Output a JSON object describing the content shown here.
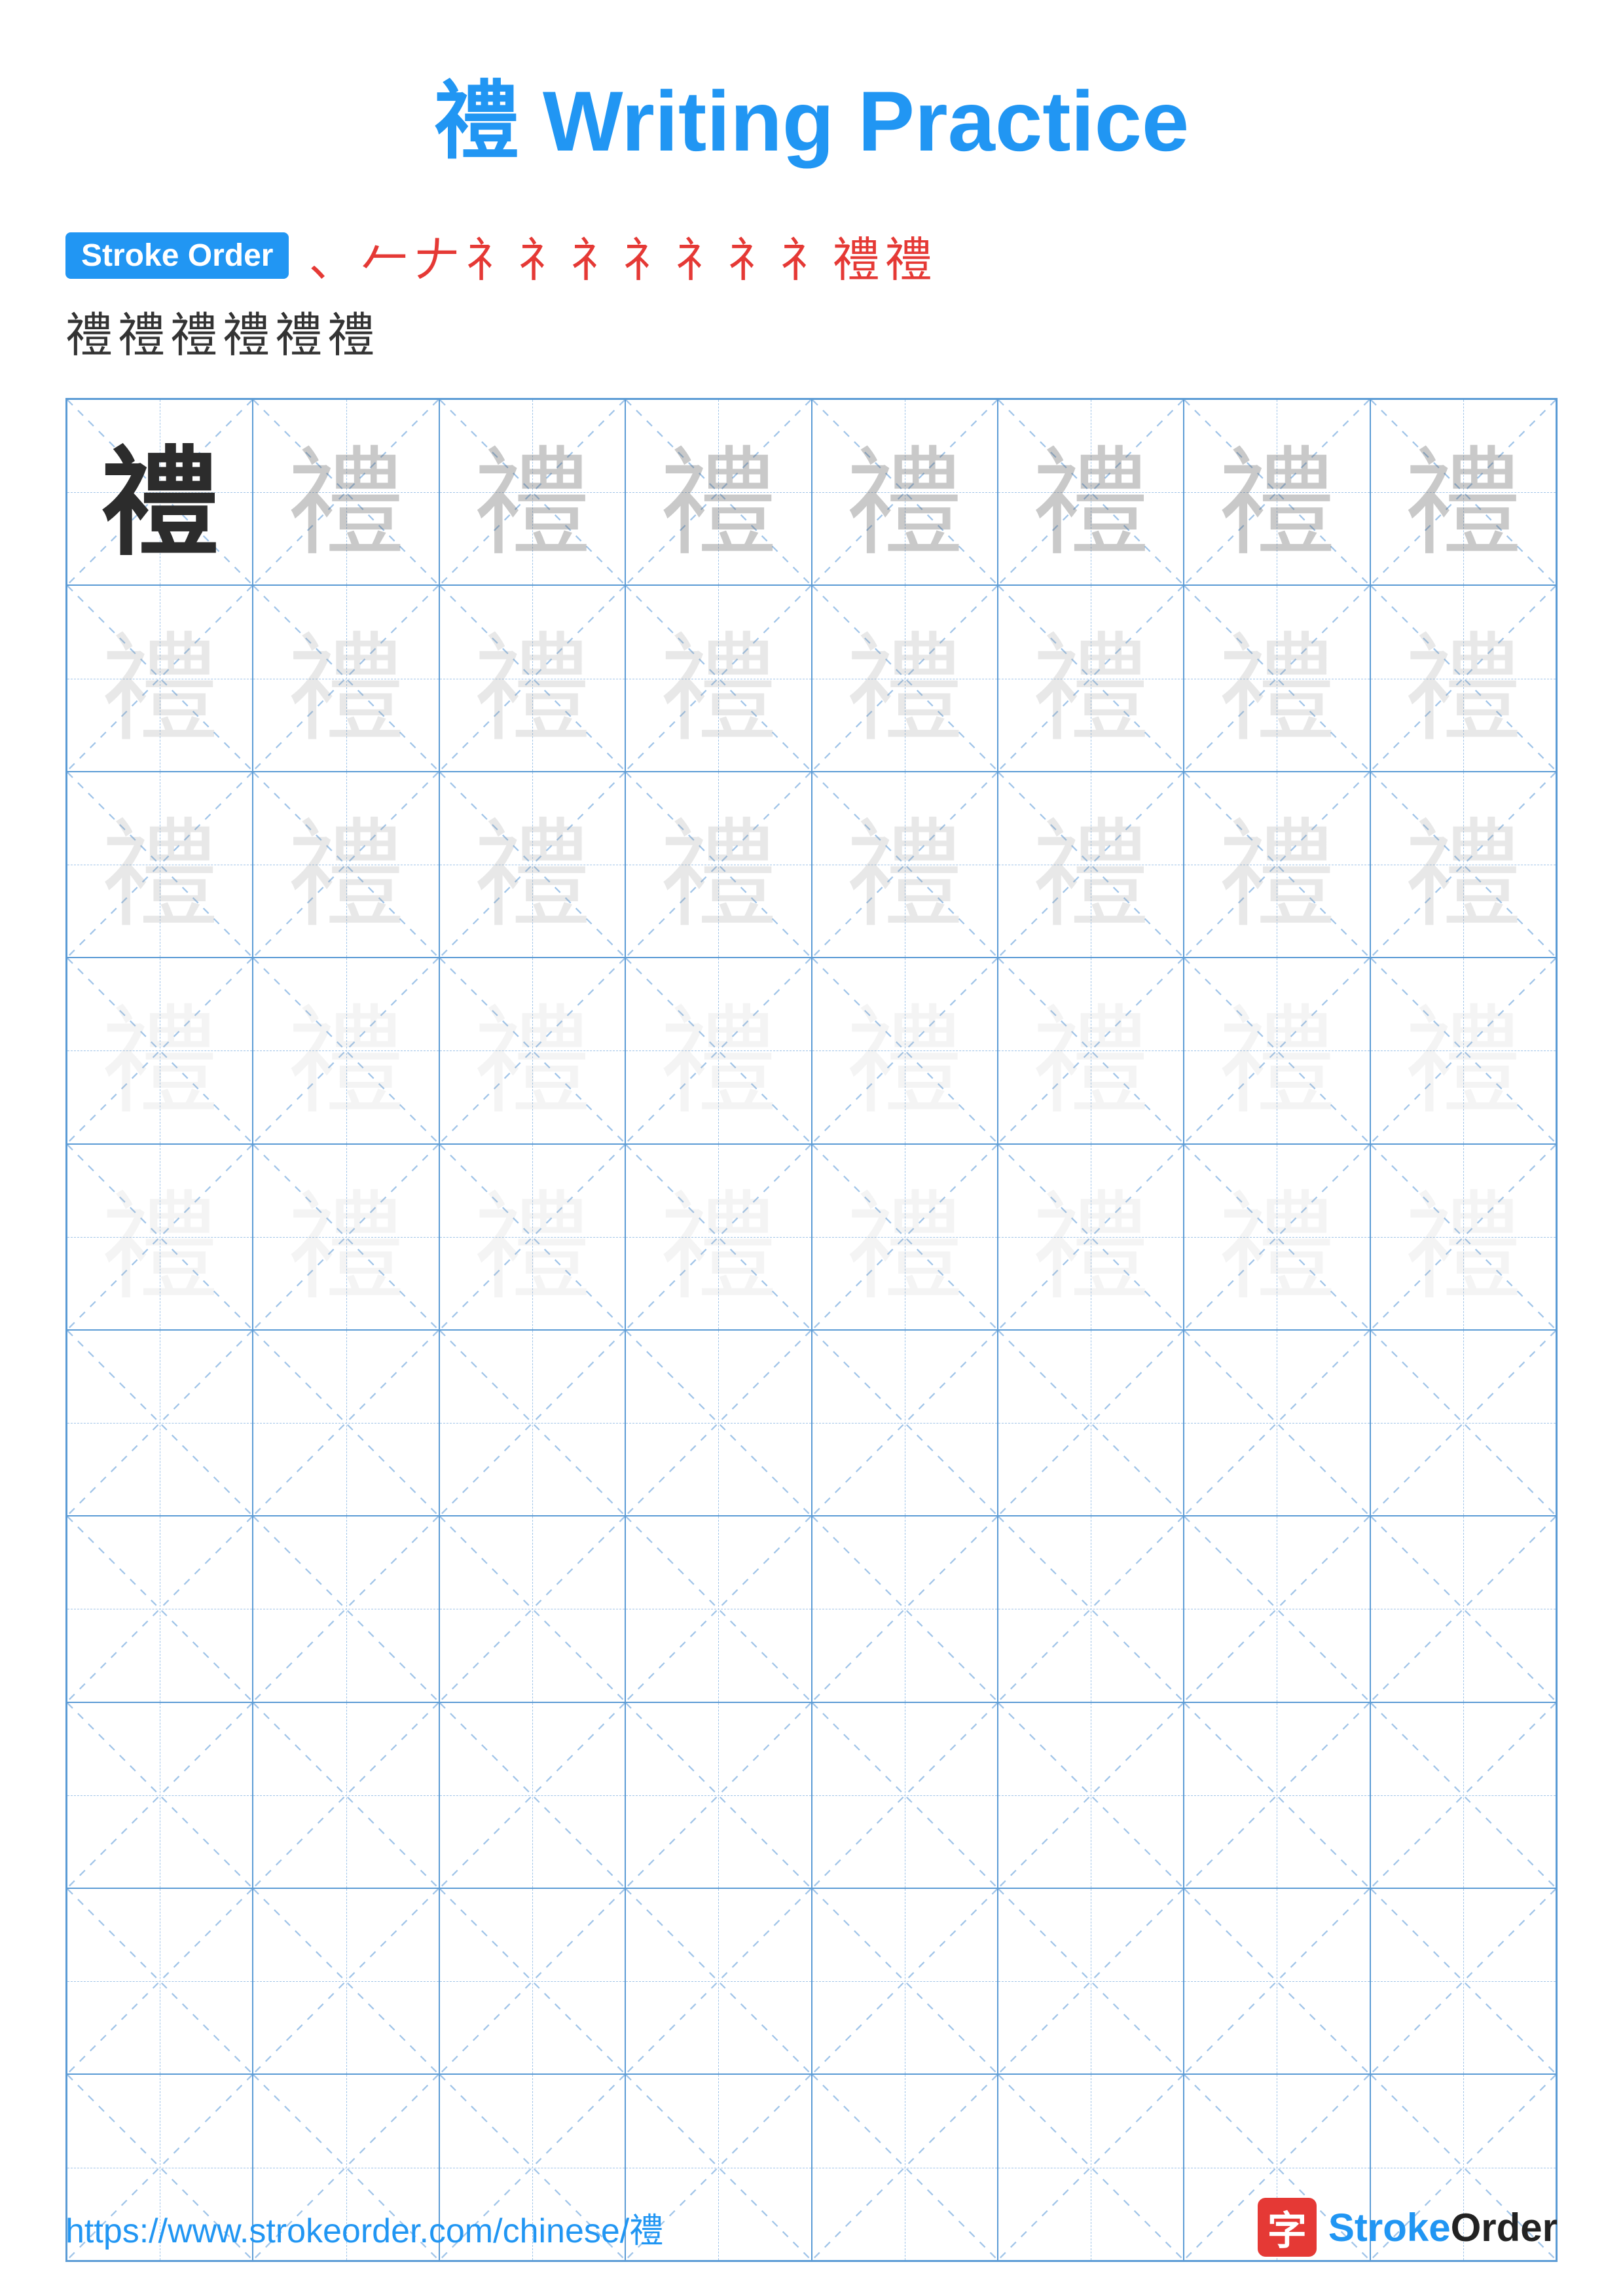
{
  "title": {
    "char": "禮",
    "label": "Writing Practice",
    "full": "禮 Writing Practice"
  },
  "stroke_order": {
    "badge_label": "Stroke Order",
    "strokes_line1": [
      "、",
      "𠂉",
      "𠂇",
      "礻",
      "礻",
      "礻",
      "礻",
      "礻",
      "礻",
      "礻",
      "禮",
      "禮"
    ],
    "strokes_line2": [
      "禮",
      "禮",
      "禮",
      "禮",
      "禮",
      "禮"
    ]
  },
  "grid": {
    "rows": 10,
    "cols": 8,
    "char": "禮",
    "char_rows_with_content": 5,
    "opacity_levels": [
      1.0,
      0.35,
      0.22,
      0.15,
      0.1
    ]
  },
  "footer": {
    "url": "https://www.strokeorder.com/chinese/禮",
    "logo_char": "字",
    "logo_name": "StrokeOrder",
    "logo_name_colored": "Stroke",
    "logo_name_plain": "Order"
  }
}
